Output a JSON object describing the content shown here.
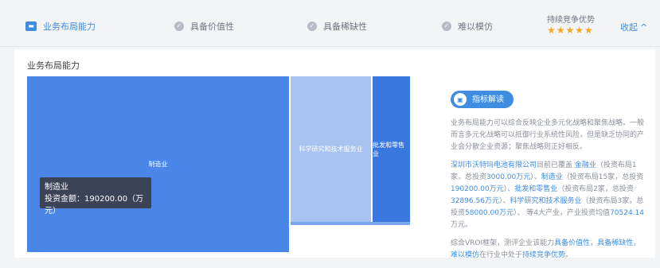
{
  "tabs": [
    {
      "label": "业务布局能力",
      "icon": "chart-icon",
      "active": true
    },
    {
      "label": "具备价值性",
      "icon": "check-circle-icon",
      "active": false
    },
    {
      "label": "具备稀缺性",
      "icon": "check-circle-icon",
      "active": false
    },
    {
      "label": "难以模仿",
      "icon": "check-circle-icon",
      "active": false
    }
  ],
  "advantage": {
    "label": "持续竞争优势",
    "stars": "★★★★★",
    "rating": 5
  },
  "collapse": {
    "label": "收起",
    "icon": "chevron-up-icon"
  },
  "panel_title": "业务布局能力",
  "treemap": {
    "labels": {
      "mfg": "制造业",
      "sci": "科学研究和技术服务业",
      "whs": "批发和零售业"
    }
  },
  "tooltip": {
    "line1": "制造业",
    "line2": "投资金额：190200.00（万元）"
  },
  "interp": {
    "badge": "指标解读",
    "p1": "业务布局能力可以综合反映企业多元化战略和聚焦战略。一般而言多元化战略可以抵御行业系统性风险，但是缺乏协同的产业会分散企业资源；聚焦战略则正好相反。",
    "p2": {
      "company": "深圳市沃特玛电池有限公司",
      "t1": "目前已覆盖 ",
      "ind1": "金融业",
      "t2": "（投资布局1家，总投资",
      "v1": "3000.00万元",
      "t3": "）、",
      "ind2": "制造业",
      "t4": "（投资布局15家，总投资",
      "v2": "190200.00万元",
      "t5": "）、",
      "ind3": "批发和零售业",
      "t6": "（投资布局2家，总投资",
      "v3": "32896.56万元",
      "t7": "）、",
      "ind4": "科学研究和技术服务业",
      "t8": "（投资布局3家，总投资",
      "v4": "58000.00万元",
      "t9": "）、 等4大产业，产业投资均值",
      "avg": "70524.14",
      "t10": "万元。"
    },
    "p3": {
      "t1": "综合VROI框架，测评企业该能力",
      "l1": "具备价值性",
      "t2": "，",
      "l2": "具备稀缺性",
      "t3": "，",
      "l3": "难以模仿",
      "t4": "在行业中处于",
      "l4": "持续竞争优势",
      "t5": "。"
    }
  },
  "colors": {
    "accent": "#3f8de0",
    "star": "#f5a623"
  }
}
